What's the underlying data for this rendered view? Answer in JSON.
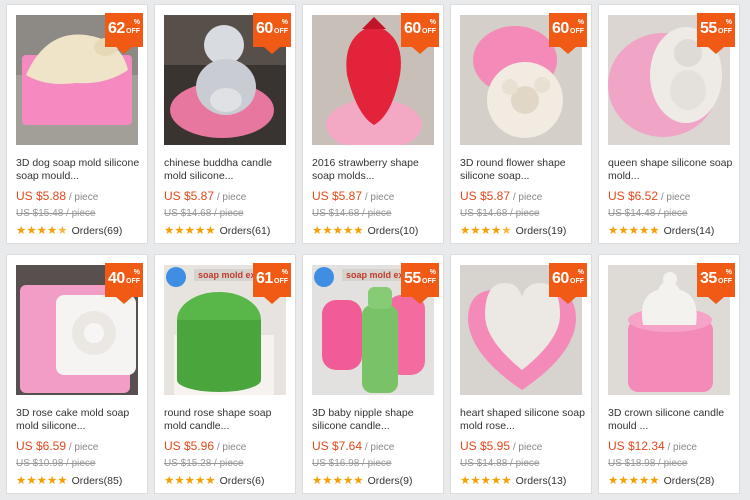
{
  "colors": {
    "badge": "#f05a14",
    "price": "#e0491a",
    "star": "#f5a000"
  },
  "badge_sym": "%",
  "badge_off": "OFF",
  "products": [
    {
      "discount": "62",
      "title": "3D dog soap mold silicone soap mould...",
      "price": "US $5.88",
      "unit": "/ piece",
      "original": "US $15.48 / piece",
      "rating": 4.5,
      "orders": "Orders(69)",
      "image": "dog-soap-mold-image"
    },
    {
      "discount": "60",
      "title": "chinese buddha candle mold silicone...",
      "price": "US $5.87",
      "unit": "/ piece",
      "original": "US $14.68 / piece",
      "rating": 5,
      "orders": "Orders(61)",
      "image": "buddha-candle-mold-image"
    },
    {
      "discount": "60",
      "title": "2016 strawberry shape soap molds...",
      "price": "US $5.87",
      "unit": "/ piece",
      "original": "US $14.68 / piece",
      "rating": 5,
      "orders": "Orders(10)",
      "image": "strawberry-soap-mold-image"
    },
    {
      "discount": "60",
      "title": "3D round flower shape silicone soap...",
      "price": "US $5.87",
      "unit": "/ piece",
      "original": "US $14.68 / piece",
      "rating": 4.5,
      "orders": "Orders(19)",
      "image": "flower-soap-mold-image"
    },
    {
      "discount": "55",
      "title": "queen shape silicone soap mold...",
      "price": "US $6.52",
      "unit": "/ piece",
      "original": "US $14.48 / piece",
      "rating": 5,
      "orders": "Orders(14)",
      "image": "queen-soap-mold-image"
    },
    {
      "discount": "40",
      "title": "3D rose cake mold soap mold silicone...",
      "price": "US $6.59",
      "unit": "/ piece",
      "original": "US $10.98 / piece",
      "rating": 5,
      "orders": "Orders(85)",
      "image": "rose-cake-mold-image"
    },
    {
      "discount": "61",
      "title": "round rose shape soap mold candle...",
      "price": "US $5.96",
      "unit": "/ piece",
      "original": "US $15.28 / piece",
      "rating": 5,
      "orders": "Orders(6)",
      "image": "round-rose-soap-mold-image",
      "watermark": "soap mold ex"
    },
    {
      "discount": "55",
      "title": "3D baby nipple shape silicone candle...",
      "price": "US $7.64",
      "unit": "/ piece",
      "original": "US $16.98 / piece",
      "rating": 5,
      "orders": "Orders(9)",
      "image": "baby-bottle-mold-image",
      "watermark": "soap mold ex"
    },
    {
      "discount": "60",
      "title": "heart shaped silicone soap mold rose...",
      "price": "US $5.95",
      "unit": "/ piece",
      "original": "US $14.88 / piece",
      "rating": 5,
      "orders": "Orders(13)",
      "image": "heart-soap-mold-image"
    },
    {
      "discount": "35",
      "title": "3D crown silicone candle mould ...",
      "price": "US $12.34",
      "unit": "/ piece",
      "original": "US $18.98 / piece",
      "rating": 5,
      "orders": "Orders(28)",
      "image": "crown-candle-mold-image"
    }
  ]
}
